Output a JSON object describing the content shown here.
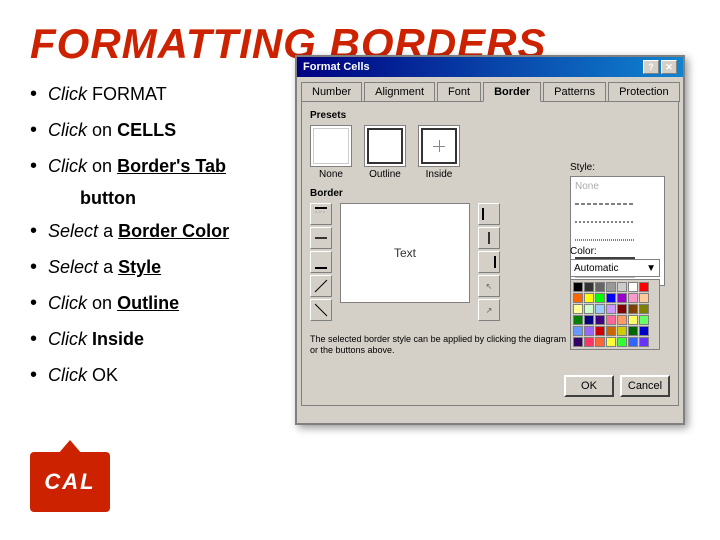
{
  "title": "FORMATTING BORDERS",
  "bullets": [
    {
      "id": "b1",
      "italic": "Click",
      "normal": " FORMAT"
    },
    {
      "id": "b2",
      "italic": "Click",
      "normal": " on ",
      "bold": "CELLS"
    },
    {
      "id": "b3",
      "italic": "Click",
      "normal": " on ",
      "bold": "Border's Tab"
    },
    {
      "id": "b4",
      "normal": "button"
    },
    {
      "id": "b5",
      "italic": "Select",
      "normal": " a ",
      "bold": "Border Color"
    },
    {
      "id": "b6",
      "italic": "Select",
      "normal": " a ",
      "bold": "Style"
    },
    {
      "id": "b7",
      "italic": "Click",
      "normal": " on ",
      "bold": "Outline"
    },
    {
      "id": "b8",
      "italic": "Click",
      "normal": " ",
      "bold": "Inside"
    },
    {
      "id": "b9",
      "italic": "Click",
      "normal": "   OK"
    }
  ],
  "dialog": {
    "title": "Format Cells",
    "tabs": [
      "Number",
      "Alignment",
      "Font",
      "Border",
      "Patterns",
      "Protection"
    ],
    "active_tab": "Border",
    "presets_label": "Presets",
    "presets": [
      "None",
      "Outline",
      "Inside"
    ],
    "border_label": "Border",
    "preview_text": "Text",
    "style_label": "Style:",
    "style_none": "None",
    "color_label": "Color:",
    "color_value": "Automatic",
    "status_text": "The selected border style can be applied by clicking the diagram or the buttons above.",
    "buttons": [
      "OK",
      "Cancel"
    ]
  },
  "colors": [
    "#000000",
    "#333333",
    "#666666",
    "#999999",
    "#cccccc",
    "#ffffff",
    "#ff0000",
    "#ff6600",
    "#ffff00",
    "#00ff00",
    "#0000ff",
    "#9900cc",
    "#ff99cc",
    "#ffcc99",
    "#ffff99",
    "#ccffcc",
    "#99ccff",
    "#cc99ff",
    "#800000",
    "#804000",
    "#808000",
    "#008000",
    "#000080",
    "#400080",
    "#ff6699",
    "#ff9966",
    "#ffff66",
    "#66ff66",
    "#6699ff",
    "#9966ff",
    "#cc0000",
    "#cc6600",
    "#cccc00",
    "#006600",
    "#0000cc",
    "#330066",
    "#ff3366",
    "#ff6633",
    "#ffff33",
    "#33ff33",
    "#3366ff",
    "#6633ff"
  ]
}
